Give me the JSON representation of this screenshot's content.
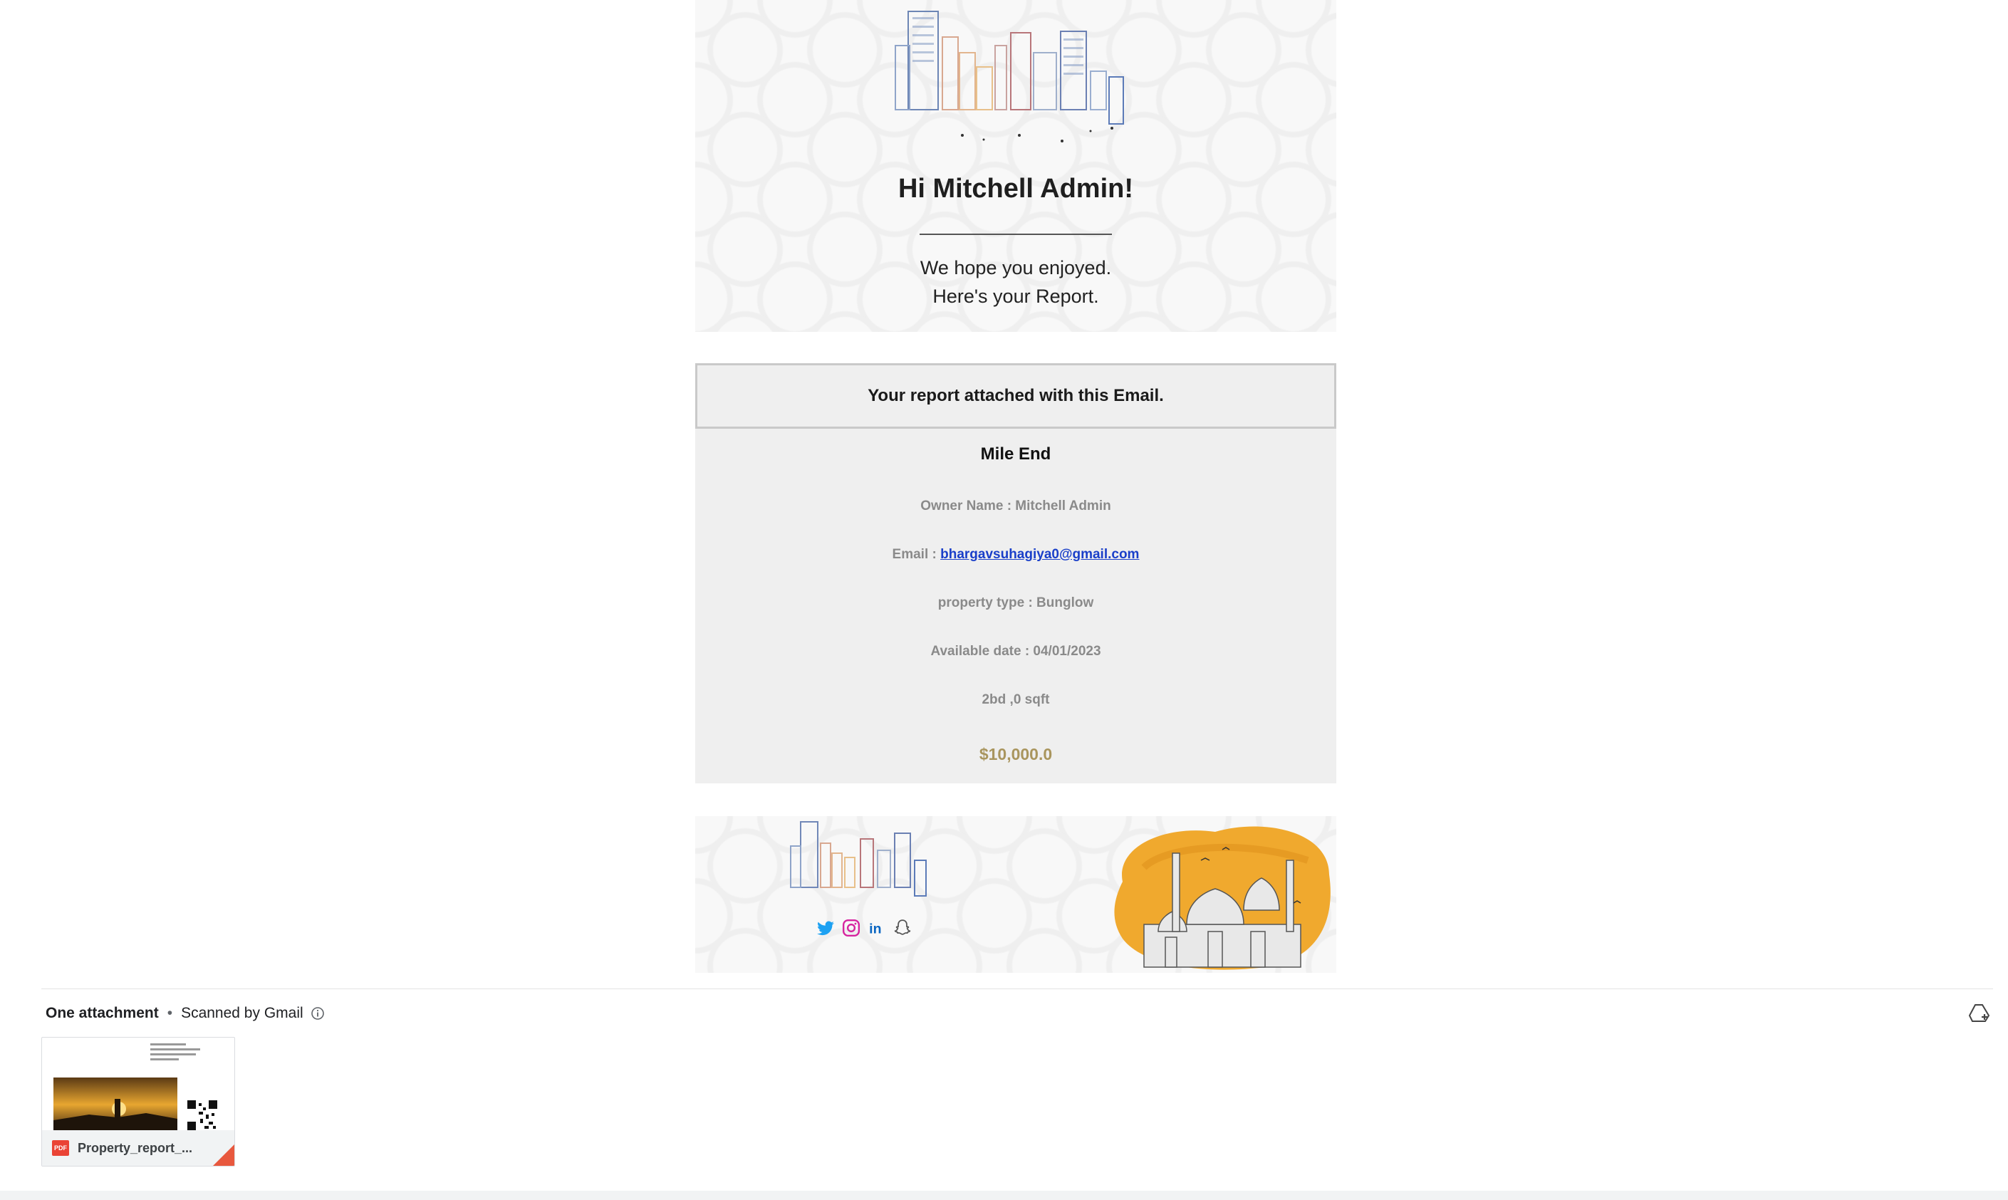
{
  "email": {
    "greeting": "Hi Mitchell Admin!",
    "message_line1": "We hope you enjoyed.",
    "message_line2": "Here's your Report.",
    "notice": "Your report attached with this Email.",
    "property": {
      "title": "Mile End",
      "owner": "Owner Name : Mitchell Admin",
      "email_label": "Email : ",
      "email_value": "bhargavsuhagiya0@gmail.com",
      "type": "property type : Bunglow",
      "available": "Available date : 04/01/2023",
      "size": "2bd ,0 sqft",
      "price": "$10,000.0"
    },
    "socials": [
      "twitter-icon",
      "instagram-icon",
      "linkedin-icon",
      "snapchat-icon"
    ]
  },
  "attachments": {
    "count_label": "One attachment",
    "scanned_label": "Scanned by Gmail",
    "file_name": "Property_report_..."
  },
  "colors": {
    "price": "#a9955d",
    "link": "#1a3fc9",
    "pdf_red": "#ea4335"
  }
}
